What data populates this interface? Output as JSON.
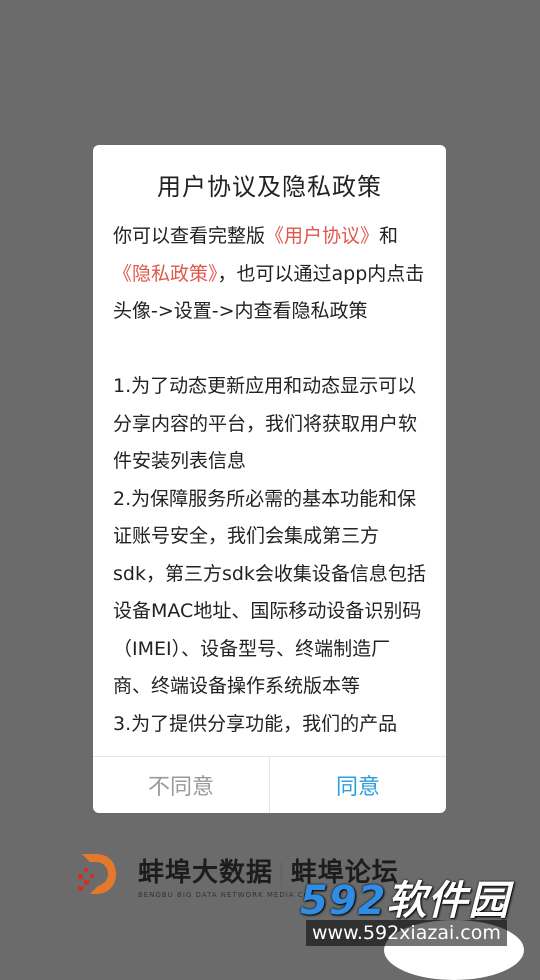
{
  "dialog": {
    "title": "用户协议及隐私政策",
    "intro": {
      "prefix": "你可以查看完整版",
      "link_user_agreement": "《用户协议》",
      "conjunction": "和",
      "link_privacy_policy": "《隐私政策》",
      "suffix": "，也可以通过app内点击头像->设置->内查看隐私政策"
    },
    "items": [
      "1.为了动态更新应用和动态显示可以分享内容的平台，我们将获取用户软件安装列表信息",
      "2.为保障服务所必需的基本功能和保证账号安全，我们会集成第三方sdk，第三方sdk会收集设备信息包括设备MAC地址、国际移动设备识别码（IMEI）、设备型号、终端制造厂商、终端设备操作系统版本等",
      "3.为了提供分享功能，我们的产品"
    ],
    "buttons": {
      "disagree": "不同意",
      "agree": "同意"
    }
  },
  "background_logo": {
    "name_cn": "蚌埠大数据",
    "divider": "|",
    "name_cn_2": "蚌埠论坛",
    "name_en": "BENGBU BIG DATA NETWORK MEDIA CO."
  },
  "watermark": {
    "number": "592",
    "text": "软件园",
    "url": "www.592xiazai.com"
  },
  "colors": {
    "link": "#e2574c",
    "agree": "#2c9fdc",
    "disagree": "#9a9a9a",
    "overlay": "#6b6b6b"
  }
}
